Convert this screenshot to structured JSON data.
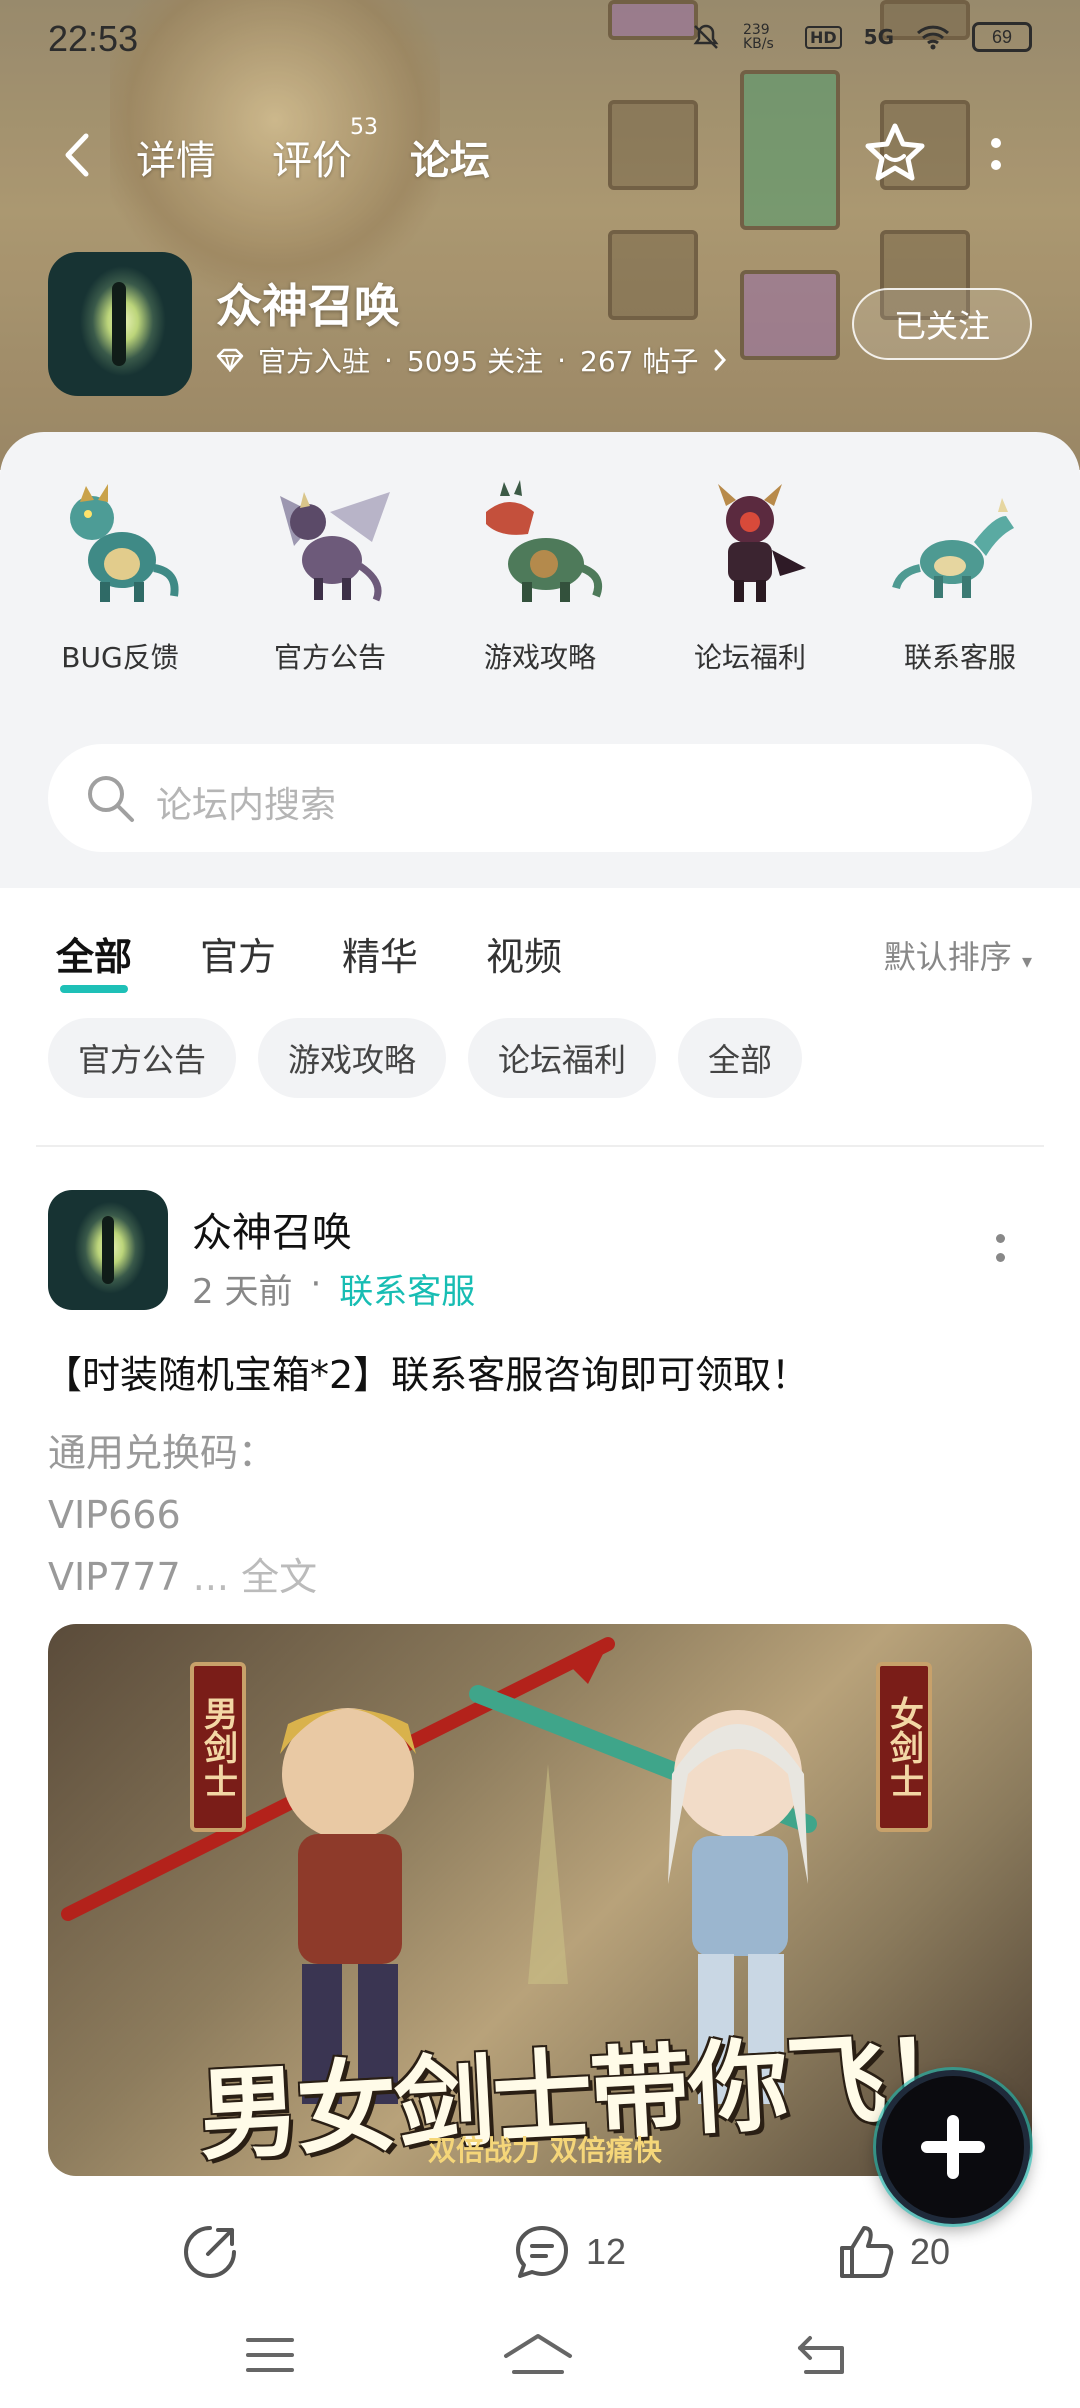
{
  "status_bar": {
    "time": "22:53",
    "net_speed": "239 KB/s",
    "hd": "HD",
    "signal": "5G",
    "battery": "69"
  },
  "nav": {
    "back_icon": "chevron-left-icon",
    "tabs": [
      {
        "label": "详情",
        "active": false
      },
      {
        "label": "评价",
        "active": false,
        "badge": "53"
      },
      {
        "label": "论坛",
        "active": true
      }
    ],
    "favorite_icon": "star-icon",
    "more_icon": "more-vertical-icon"
  },
  "game": {
    "title": "众神召唤",
    "official": "官方入驻",
    "followers": "5095 关注",
    "posts": "267 帖子",
    "follow_label": "已关注"
  },
  "categories": [
    {
      "label": "BUG反馈",
      "color": "#3f8a86"
    },
    {
      "label": "官方公告",
      "color": "#6d5a7a"
    },
    {
      "label": "游戏攻略",
      "color": "#c4503c"
    },
    {
      "label": "论坛福利",
      "color": "#5b2a3f"
    },
    {
      "label": "联系客服",
      "color": "#4e9a92"
    }
  ],
  "search": {
    "placeholder": "论坛内搜索"
  },
  "filter_tabs": [
    {
      "label": "全部",
      "active": true
    },
    {
      "label": "官方",
      "active": false
    },
    {
      "label": "精华",
      "active": false
    },
    {
      "label": "视频",
      "active": false
    }
  ],
  "sort_label": "默认排序",
  "chips": [
    "官方公告",
    "游戏攻略",
    "论坛福利",
    "全部"
  ],
  "post": {
    "author": "众神召唤",
    "time": "2 天前",
    "tag": "联系客服",
    "title": "【时装随机宝箱*2】联系客服咨询即可领取！",
    "body_lines": [
      "通用兑换码：",
      "VIP666",
      "VIP777"
    ],
    "ellipsis": "...",
    "more_link": "全文",
    "image": {
      "banner_left": "男剑士",
      "banner_right": "女剑士",
      "headline": "男女剑士带你飞！",
      "subline": "双倍战力 双倍痛快"
    },
    "comments": "12",
    "likes": "20"
  },
  "colors": {
    "accent": "#1ec0b7",
    "tag": "#17bdb3"
  }
}
